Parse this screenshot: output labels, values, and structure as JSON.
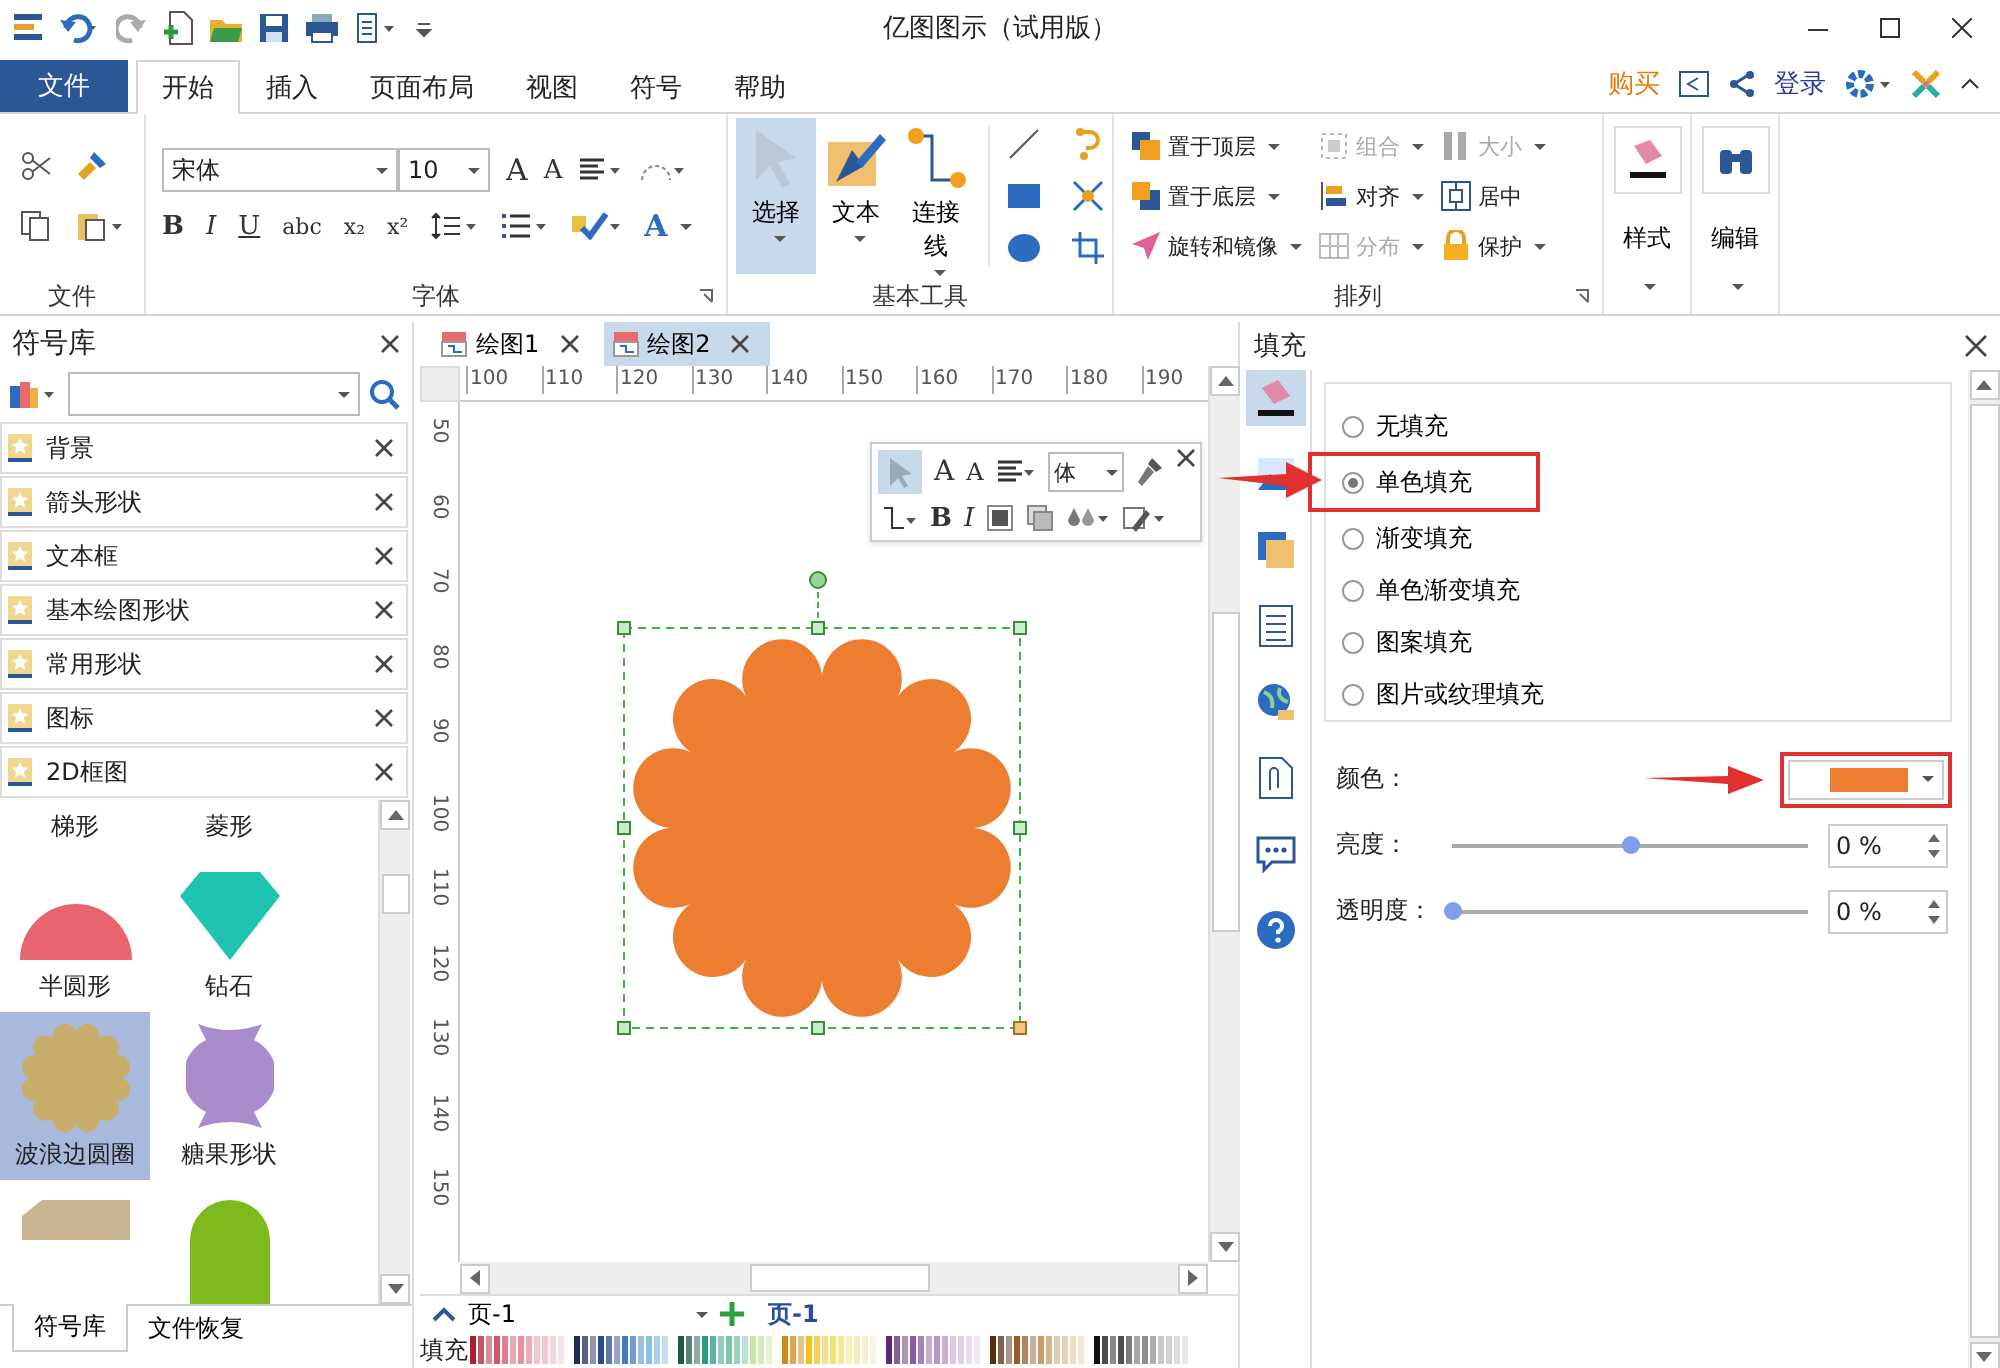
{
  "window": {
    "title": "亿图图示（试用版）"
  },
  "file_menu": "文件",
  "tabs": [
    {
      "label": "开始",
      "selected": true
    },
    {
      "label": "插入",
      "selected": false
    },
    {
      "label": "页面布局",
      "selected": false
    },
    {
      "label": "视图",
      "selected": false
    },
    {
      "label": "符号",
      "selected": false
    },
    {
      "label": "帮助",
      "selected": false
    }
  ],
  "account": {
    "buy": "购买",
    "login": "登录"
  },
  "ribbon": {
    "clipboard": {
      "label": "文件"
    },
    "font": {
      "label": "字体",
      "font_name": "宋体",
      "font_size": "10",
      "grow": "A",
      "shrink": "A",
      "format_buttons": [
        "B",
        "I",
        "U",
        "abc",
        "x₂",
        "x²"
      ],
      "color_button": "A"
    },
    "tools": {
      "label": "基本工具",
      "buttons": [
        {
          "label": "选择",
          "selected": true
        },
        {
          "label": "文本",
          "selected": false
        },
        {
          "label": "连接线",
          "selected": false
        }
      ]
    },
    "arrange": {
      "label": "排列",
      "items": [
        {
          "label": "置于顶层",
          "disabled": false,
          "menu": true
        },
        {
          "label": "组合",
          "disabled": true,
          "menu": true
        },
        {
          "label": "大小",
          "disabled": true,
          "menu": true
        },
        {
          "label": "置于底层",
          "disabled": false,
          "menu": true
        },
        {
          "label": "对齐",
          "disabled": false,
          "menu": true
        },
        {
          "label": "居中",
          "disabled": false,
          "menu": false
        },
        {
          "label": "旋转和镜像",
          "disabled": false,
          "menu": true
        },
        {
          "label": "分布",
          "disabled": true,
          "menu": true
        },
        {
          "label": "保护",
          "disabled": false,
          "menu": true
        }
      ]
    },
    "large_buttons": [
      {
        "label": "样式"
      },
      {
        "label": "编辑"
      }
    ]
  },
  "library": {
    "title": "符号库",
    "items": [
      {
        "label": "背景"
      },
      {
        "label": "箭头形状"
      },
      {
        "label": "文本框"
      },
      {
        "label": "基本绘图形状"
      },
      {
        "label": "常用形状"
      },
      {
        "label": "图标"
      },
      {
        "label": "2D框图"
      }
    ],
    "shapes": [
      {
        "label": "梯形",
        "selected": false
      },
      {
        "label": "菱形",
        "selected": false
      },
      {
        "kind": "semicircle",
        "label": "半圆形",
        "selected": false
      },
      {
        "kind": "diamond",
        "label": "钻石",
        "selected": false
      },
      {
        "kind": "wavy-circle",
        "label": "波浪边圆圈",
        "selected": true
      },
      {
        "kind": "candy",
        "label": "糖果形状",
        "selected": false
      },
      {
        "kind": "cut-corner",
        "selected": false
      },
      {
        "kind": "arch",
        "selected": false
      }
    ],
    "bottom_tabs": [
      {
        "label": "符号库",
        "selected": true
      },
      {
        "label": "文件恢复",
        "selected": false
      }
    ]
  },
  "documents": [
    {
      "label": "绘图1",
      "selected": false
    },
    {
      "label": "绘图2",
      "selected": true
    }
  ],
  "h_ruler": [
    "100",
    "110",
    "120",
    "130",
    "140",
    "150",
    "160",
    "170",
    "180",
    "190"
  ],
  "v_ruler": [
    "50",
    "60",
    "70",
    "80",
    "90",
    "100",
    "110",
    "120",
    "130",
    "140",
    "150"
  ],
  "mini_toolbar": {
    "grow": "A",
    "shrink": "A",
    "font": "体",
    "bold": "B",
    "italic": "I"
  },
  "pages": {
    "selector": "页-1",
    "tabs": [
      {
        "label": "页-1",
        "selected": true
      }
    ]
  },
  "palette": {
    "label": "填充"
  },
  "fill_panel": {
    "title": "填充",
    "options": [
      {
        "label": "无填充",
        "selected": false,
        "highlighted": false
      },
      {
        "label": "单色填充",
        "selected": true,
        "highlighted": true
      },
      {
        "label": "渐变填充",
        "selected": false,
        "highlighted": false
      },
      {
        "label": "单色渐变填充",
        "selected": false,
        "highlighted": false
      },
      {
        "label": "图案填充",
        "selected": false,
        "highlighted": false
      },
      {
        "label": "图片或纹理填充",
        "selected": false,
        "highlighted": false
      }
    ],
    "color": {
      "label": "颜色：",
      "color": "#ed7d31",
      "highlighted": true
    },
    "sliders": [
      {
        "label": "亮度：",
        "level": 0.5,
        "value": "0 %"
      },
      {
        "label": "透明度：",
        "level": 0,
        "value": "0 %"
      }
    ]
  }
}
